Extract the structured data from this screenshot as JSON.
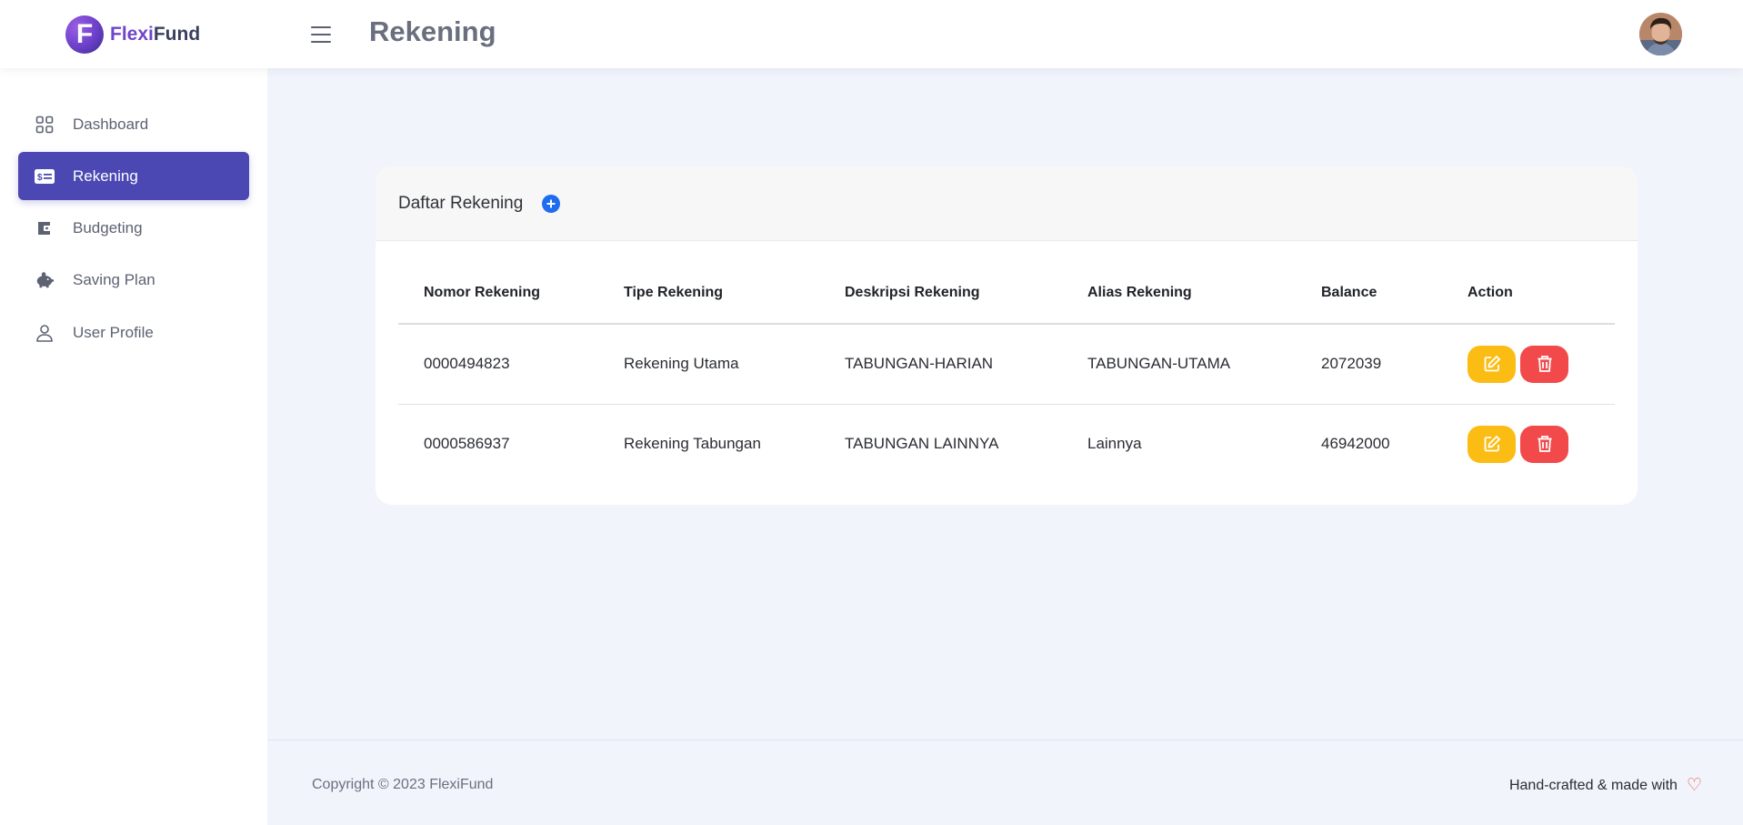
{
  "brand": {
    "name_part1": "Flexi",
    "name_part2": "Fund",
    "logo_letter": "F"
  },
  "header": {
    "title": "Rekening"
  },
  "sidebar": {
    "items": [
      {
        "label": "Dashboard",
        "icon": "grid-icon",
        "active": false
      },
      {
        "label": "Rekening",
        "icon": "money-card-icon",
        "active": true
      },
      {
        "label": "Budgeting",
        "icon": "wallet-icon",
        "active": false
      },
      {
        "label": "Saving Plan",
        "icon": "piggy-bank-icon",
        "active": false
      },
      {
        "label": "User Profile",
        "icon": "user-icon",
        "active": false
      }
    ]
  },
  "card": {
    "title": "Daftar Rekening",
    "columns": [
      "Nomor Rekening",
      "Tipe Rekening",
      "Deskripsi Rekening",
      "Alias Rekening",
      "Balance",
      "Action"
    ],
    "rows": [
      {
        "nomor": "0000494823",
        "tipe": "Rekening Utama",
        "deskripsi": "TABUNGAN-HARIAN",
        "alias": "TABUNGAN-UTAMA",
        "balance": "2072039"
      },
      {
        "nomor": "0000586937",
        "tipe": "Rekening Tabungan",
        "deskripsi": "TABUNGAN LAINNYA",
        "alias": "Lainnya",
        "balance": "46942000"
      }
    ]
  },
  "footer": {
    "copyright": "Copyright © 2023 FlexiFund",
    "made_with": "Hand-crafted & made with",
    "heart": "♡"
  },
  "colors": {
    "accent": "#4b48b3",
    "edit": "#fbbd14",
    "delete": "#f24a4a",
    "add": "#1e6cf0"
  }
}
